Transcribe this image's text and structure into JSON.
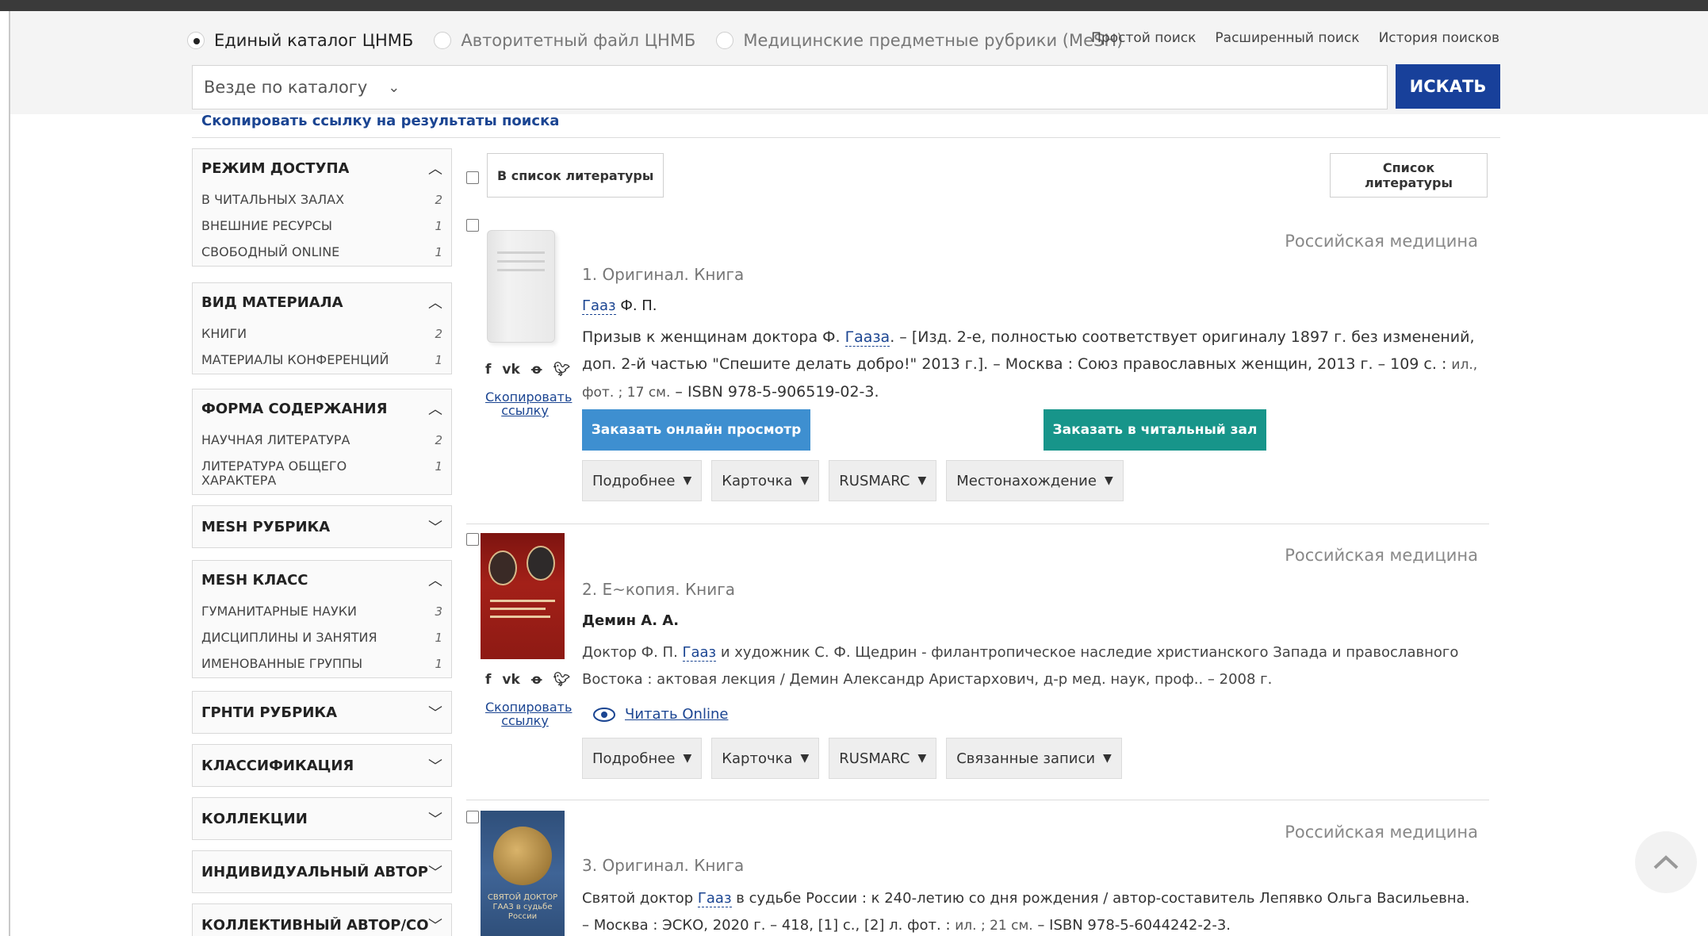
{
  "search": {
    "radios": [
      {
        "label": "Единый каталог ЦНМБ",
        "checked": true
      },
      {
        "label": "Авторитетный файл ЦНМБ",
        "checked": false
      },
      {
        "label": "Медицинские предметные рубрики (MeSH)",
        "checked": false
      }
    ],
    "links": [
      "Простой поиск",
      "Расширенный поиск",
      "История поисков"
    ],
    "scope": "Везде по каталогу",
    "query": "",
    "button": "ИСКАТЬ",
    "copy_link": "Скопировать ссылку на результаты поиска"
  },
  "facets": [
    {
      "title": "РЕЖИМ ДОСТУПА",
      "expanded": true,
      "items": [
        {
          "label": "В ЧИТАЛЬНЫХ ЗАЛАХ",
          "count": "2"
        },
        {
          "label": "ВНЕШНИЕ РЕСУРСЫ",
          "count": "1"
        },
        {
          "label": "СВОБОДНЫЙ ONLINE",
          "count": "1"
        }
      ]
    },
    {
      "title": "ВИД МАТЕРИАЛА",
      "expanded": true,
      "items": [
        {
          "label": "КНИГИ",
          "count": "2"
        },
        {
          "label": "МАТЕРИАЛЫ КОНФЕРЕНЦИЙ",
          "count": "1"
        }
      ]
    },
    {
      "title": "ФОРМА СОДЕРЖАНИЯ",
      "expanded": true,
      "items": [
        {
          "label": "НАУЧНАЯ ЛИТЕРАТУРА",
          "count": "2"
        },
        {
          "label": "ЛИТЕРАТУРА ОБЩЕГО ХАРАКТЕРА",
          "count": "1"
        }
      ]
    },
    {
      "title": "MESH РУБРИКА",
      "expanded": false,
      "items": []
    },
    {
      "title": "MESH КЛАСС",
      "expanded": true,
      "items": [
        {
          "label": "ГУМАНИТАРНЫЕ НАУКИ",
          "count": "3"
        },
        {
          "label": "ДИСЦИПЛИНЫ И ЗАНЯТИЯ",
          "count": "1"
        },
        {
          "label": "ИМЕНОВАННЫЕ ГРУППЫ",
          "count": "1"
        }
      ]
    },
    {
      "title": "ГРНТИ РУБРИКА",
      "expanded": false,
      "items": []
    },
    {
      "title": "КЛАССИФИКАЦИЯ",
      "expanded": false,
      "items": []
    },
    {
      "title": "КОЛЛЕКЦИИ",
      "expanded": false,
      "items": []
    },
    {
      "title": "ИНДИВИДУАЛЬНЫЙ АВТОР/СО",
      "expanded": false,
      "items": []
    },
    {
      "title": "КОЛЛЕКТИВНЫЙ АВТОР/СОЗД",
      "expanded": false,
      "items": []
    }
  ],
  "biblio": {
    "add_btn": "В список литературы",
    "list_btn": "Список литературы"
  },
  "social": {
    "fb": "f",
    "vk": "vk",
    "ok": "ok",
    "tw": "tw",
    "copy": "Скопировать ссылку"
  },
  "records": [
    {
      "provider": "Российская медицина",
      "title": "1. Оригинал. Книга",
      "author_link": "Гааз",
      "author_rest": " Ф. П.",
      "desc_a": "Призыв к женщинам доктора Ф. ",
      "desc_link": "Гааза",
      "desc_b": ". – [Изд. 2-е, полностью соответствует оригиналу 1897 г. без изменений, доп. 2-й частью \"Спешите делать добро!\" 2013 г.]. – Москва : Союз православных женщин, 2013 г. – 109 с. : ",
      "desc_small": "ил., фот. ; 17 см.",
      "desc_c": " – ISBN 978-5-906519-02-3.",
      "btn_online": "Заказать онлайн просмотр",
      "btn_hall": "Заказать в читальный зал",
      "tabs": [
        "Подробнее",
        "Карточка",
        "RUSMARC",
        "Местонахождение"
      ]
    },
    {
      "provider": "Российская медицина",
      "title": "2. Е~копия. Книга",
      "author": "Демин А. А.",
      "desc_a": "Доктор Ф. П. ",
      "desc_link": "Гааз",
      "desc_b": " и художник С. Ф. Щедрин - филантропическое наследие христианского Запада и православного Востока : актовая лекция / Демин Александр Аристархович, д-р мед. наук, проф.. – 2008 г.",
      "read_online": "Читать Online",
      "tabs": [
        "Подробнее",
        "Карточка",
        "RUSMARC",
        "Связанные записи"
      ]
    },
    {
      "provider": "Российская медицина",
      "title": "3. Оригинал. Книга",
      "desc_a": "Святой доктор ",
      "desc_link": "Гааз",
      "desc_b": " в судьбе России : к 240-летию со дня рождения / автор-составитель Лепявко Ольга Васильевна. – Москва : ЭСКО, 2020 г. – 418, [1] с., [2] л. фот. : ",
      "desc_small": "ил. ; 21 см.",
      "desc_c": " – ISBN 978-5-6044242-2-3.",
      "cover_text": "СВЯТОЙ ДОКТОР ГААЗ в судьбе России"
    }
  ],
  "colors": {
    "primary": "#18409a",
    "link": "#1b4592",
    "teal": "#17958a",
    "blue": "#3e8fd0"
  }
}
